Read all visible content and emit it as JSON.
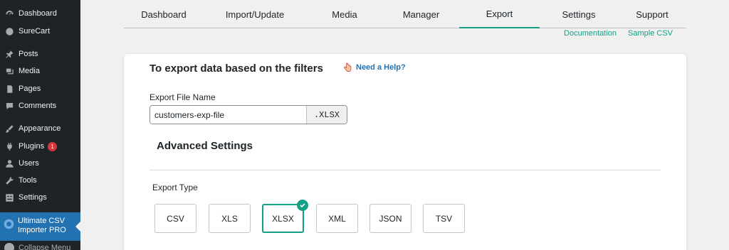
{
  "sidebar": {
    "items": [
      {
        "label": "Dashboard",
        "icon": "dashboard-icon"
      },
      {
        "label": "SureCart",
        "icon": "surecart-icon"
      },
      {
        "label": "Posts",
        "icon": "pin-icon"
      },
      {
        "label": "Media",
        "icon": "media-icon"
      },
      {
        "label": "Pages",
        "icon": "pages-icon"
      },
      {
        "label": "Comments",
        "icon": "comments-icon"
      },
      {
        "label": "Appearance",
        "icon": "brush-icon"
      },
      {
        "label": "Plugins",
        "icon": "plugin-icon",
        "badge": "1"
      },
      {
        "label": "Users",
        "icon": "users-icon"
      },
      {
        "label": "Tools",
        "icon": "wrench-icon"
      },
      {
        "label": "Settings",
        "icon": "settings-icon"
      }
    ],
    "active": {
      "label_line1": "Ultimate CSV",
      "label_line2": "Importer PRO"
    },
    "collapse": "Collapse Menu"
  },
  "tabs": [
    {
      "label": "Dashboard"
    },
    {
      "label": "Import/Update"
    },
    {
      "label": "Media"
    },
    {
      "label": "Manager"
    },
    {
      "label": "Export",
      "active": true
    },
    {
      "label": "Settings"
    },
    {
      "label": "Support"
    }
  ],
  "links": {
    "documentation": "Documentation",
    "sample_csv": "Sample CSV"
  },
  "card": {
    "title": "To export data based on the filters",
    "help": "Need a Help?",
    "file_name_label": "Export File Name",
    "file_name_value": "customers-exp-file",
    "extension": ".XLSX",
    "advanced_title": "Advanced Settings",
    "export_type_label": "Export Type",
    "export_types": [
      "CSV",
      "XLS",
      "XLSX",
      "XML",
      "JSON",
      "TSV"
    ],
    "selected_type": "XLSX"
  },
  "colors": {
    "accent": "#14a085",
    "sidebar_bg": "#1d2327",
    "active_menu": "#2271b1",
    "link_blue": "#2271b1"
  }
}
